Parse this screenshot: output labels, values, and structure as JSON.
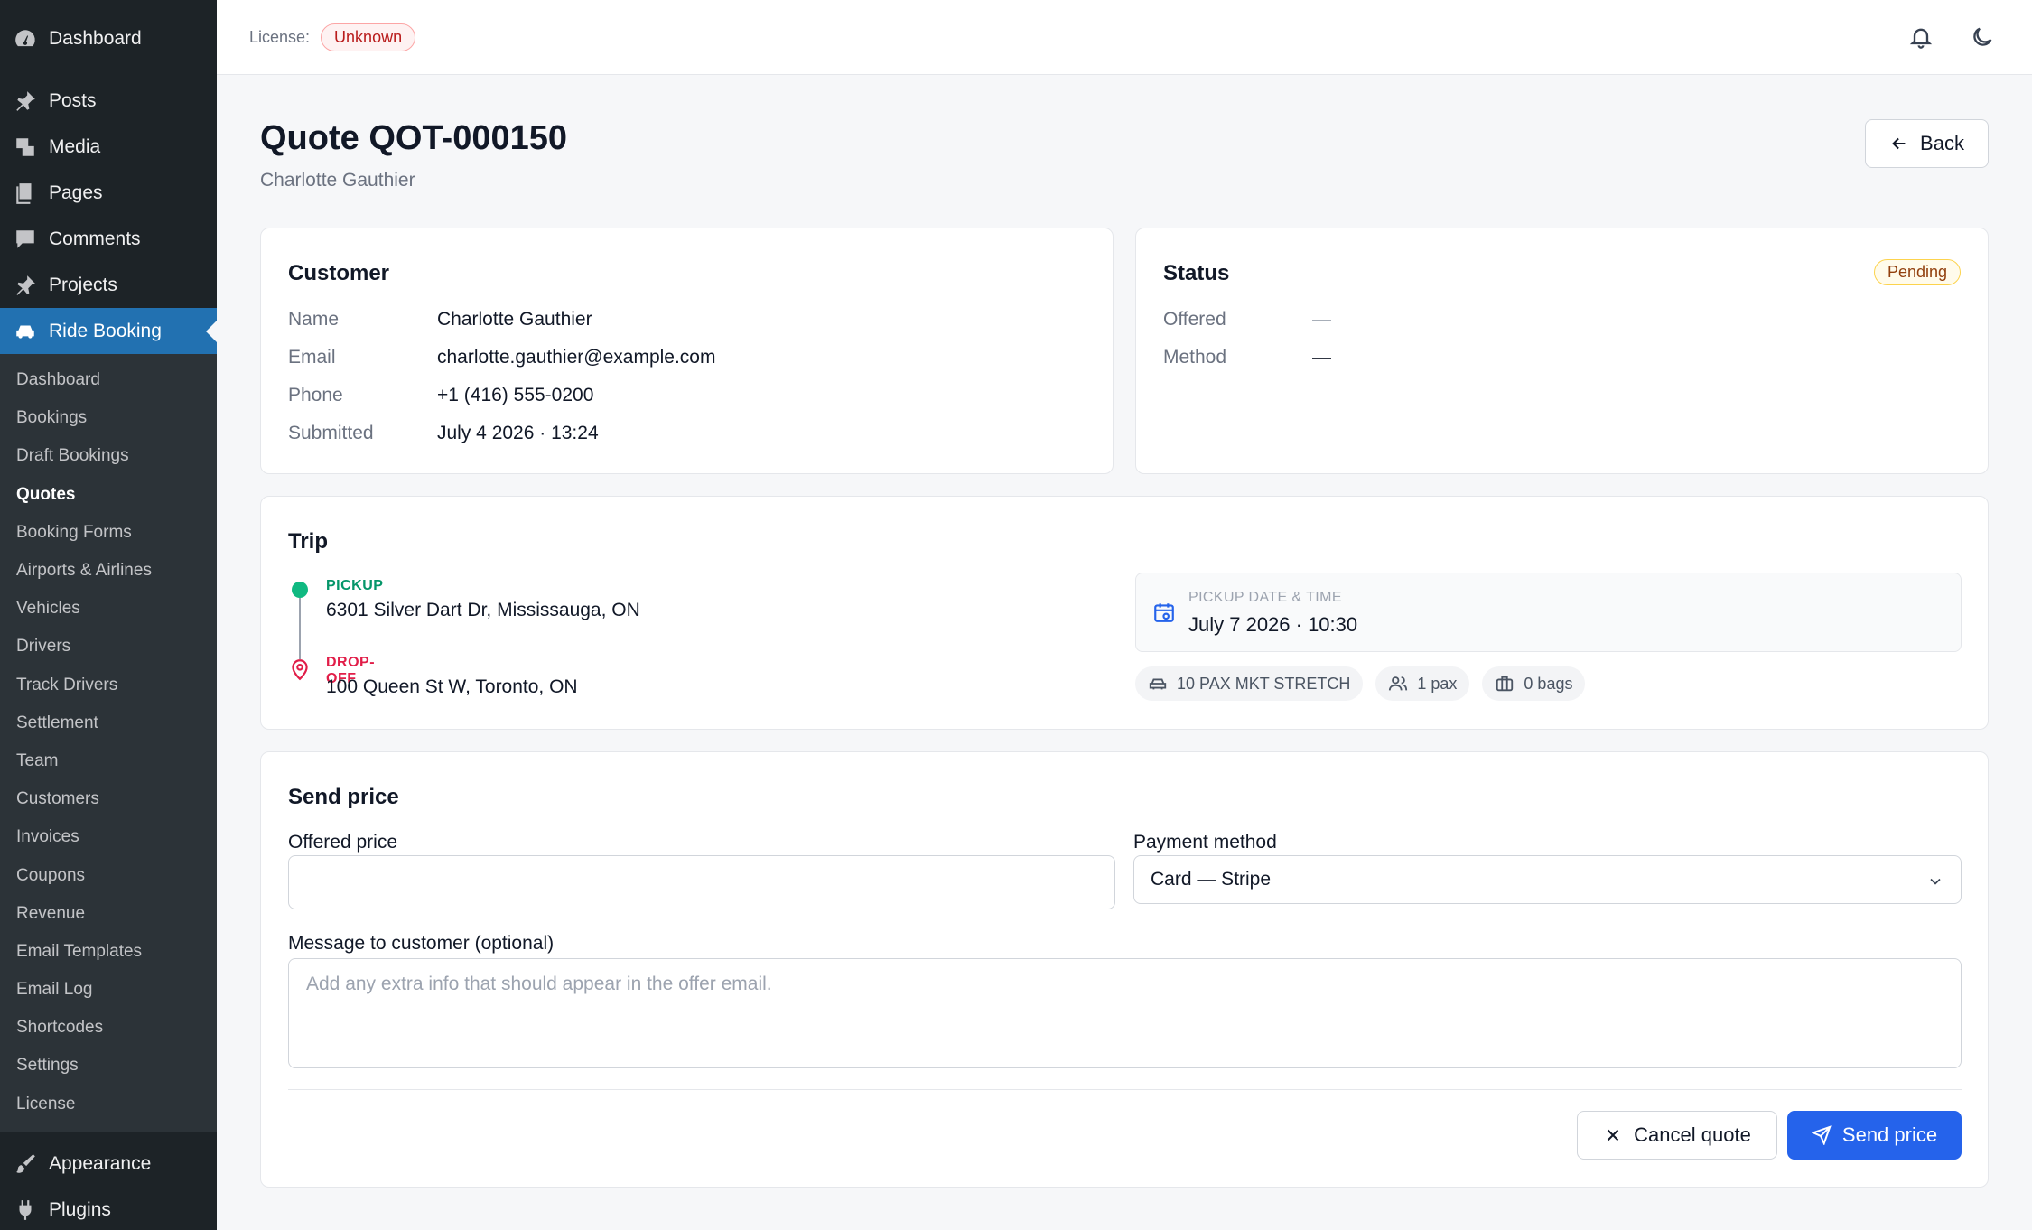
{
  "sidebar": {
    "top_items": [
      {
        "label": "Dashboard",
        "icon": "dashboard-icon"
      },
      {
        "label": "Posts",
        "icon": "pin-icon"
      },
      {
        "label": "Media",
        "icon": "media-icon"
      },
      {
        "label": "Pages",
        "icon": "pages-icon"
      },
      {
        "label": "Comments",
        "icon": "comments-icon"
      },
      {
        "label": "Projects",
        "icon": "pin-icon"
      },
      {
        "label": "Ride Booking",
        "icon": "car-icon"
      }
    ],
    "submenu": [
      "Dashboard",
      "Bookings",
      "Draft Bookings",
      "Quotes",
      "Booking Forms",
      "Airports & Airlines",
      "Vehicles",
      "Drivers",
      "Track Drivers",
      "Settlement",
      "Team",
      "Customers",
      "Invoices",
      "Coupons",
      "Revenue",
      "Email Templates",
      "Email Log",
      "Shortcodes",
      "Settings",
      "License"
    ],
    "current_sub": "Quotes",
    "bottom_items": [
      {
        "label": "Appearance",
        "icon": "brush-icon"
      },
      {
        "label": "Plugins",
        "icon": "plugin-icon"
      }
    ]
  },
  "topbar": {
    "license_label": "License:",
    "license_status": "Unknown",
    "license_status_color": "#b91c1c"
  },
  "header": {
    "title": "Quote QOT-000150",
    "subtitle": "Charlotte Gauthier",
    "back_label": "Back"
  },
  "customer": {
    "title": "Customer",
    "rows": [
      {
        "key": "Name",
        "value": "Charlotte Gauthier"
      },
      {
        "key": "Email",
        "value": "charlotte.gauthier@example.com"
      },
      {
        "key": "Phone",
        "value": "+1 (416) 555-0200"
      },
      {
        "key": "Submitted",
        "value": "July 4 2026 · 13:24"
      }
    ]
  },
  "status": {
    "title": "Status",
    "badge": "Pending",
    "rows": [
      {
        "key": "Offered",
        "value": "—"
      },
      {
        "key": "Method",
        "value": "—"
      }
    ]
  },
  "trip": {
    "title": "Trip",
    "pickup_label": "PICKUP",
    "pickup_address": "6301 Silver Dart Dr, Mississauga, ON",
    "dropoff_label": "DROP-OFF",
    "dropoff_address": "100 Queen St W, Toronto, ON",
    "datetime_label": "PICKUP DATE & TIME",
    "datetime_value": "July 7 2026 · 10:30",
    "vehicle": "10 PAX MKT STRETCH",
    "passengers": "1 pax",
    "bags": "0 bags",
    "pickup_color": "#059669",
    "dropoff_color": "#e11d48"
  },
  "send_price": {
    "title": "Send price",
    "offered_price_label": "Offered price",
    "offered_price_value": "",
    "payment_method_label": "Payment method",
    "payment_method_value": "Card — Stripe",
    "message_label": "Message to customer (optional)",
    "message_placeholder": "Add any extra info that should appear in the offer email.",
    "cancel_label": "Cancel quote",
    "send_label": "Send price",
    "accent_color": "#2563eb"
  }
}
